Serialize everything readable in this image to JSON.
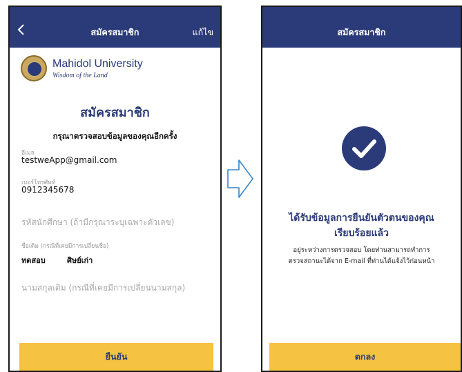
{
  "left_screen": {
    "header": {
      "title": "สมัครสมาชิก",
      "edit_label": "แก้ไข"
    },
    "logo": {
      "name": "Mahidol University",
      "tagline": "Wisdom of the Land"
    },
    "form_title": "สมัครสมาชิก",
    "subtitle": "กรุณาตรวจสอบข้อมูลของคุณอีกครั้ง",
    "fields": {
      "email": {
        "label": "อีเมล",
        "value": "testweApp@gmail.com"
      },
      "phone": {
        "label": "เบอร์โทรศัพท์",
        "value": "0912345678"
      },
      "student_id": {
        "placeholder": "รหัสนักศึกษา (ถ้ามีกรุณาระบุเฉพาะตัวเลข)"
      },
      "old_name": {
        "label": "ชื่อเดิม (กรณีที่เคยมีการเปลี่ยนชื่อ)",
        "first": "ทดสอบ",
        "last": "ศิษย์เก่า"
      },
      "old_surname": {
        "placeholder": "นามสกุลเดิม (กรณีที่เคยมีการเปลี่ยนนามสกุล)"
      }
    },
    "confirm_button": "ยืนยัน"
  },
  "right_screen": {
    "header": {
      "title": "สมัครสมาชิก"
    },
    "success_title_line1": "ได้รับข้อมูลการยืนยันตัวตนของคุณ",
    "success_title_line2": "เรียบร้อยแล้ว",
    "desc_line1": "อยู่ระหว่างการตรวจสอบ โดยท่านสามารถทำการ",
    "desc_line2": "ตรวจสถานะได้จาก E-mail ที่ท่านได้แจ้งไว้ก่อนหน้า",
    "ok_button": "ตกลง"
  },
  "colors": {
    "navy": "#2b3a78",
    "yellow": "#f5c242"
  },
  "icons": {
    "back": "chevron-left-icon",
    "success": "check-circle-icon",
    "transition": "arrow-right-outline-icon"
  }
}
